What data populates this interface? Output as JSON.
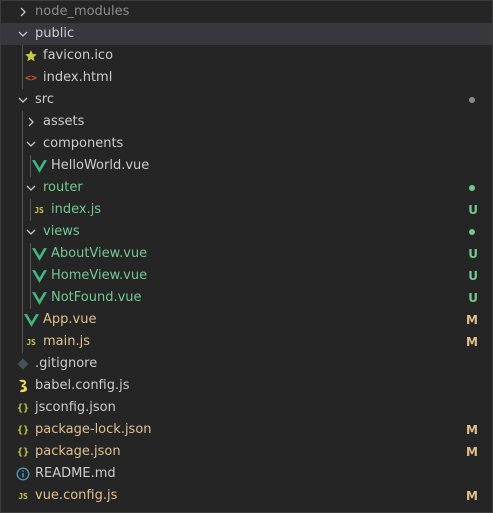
{
  "colors": {
    "background": "#252526",
    "selected_row": "#37373d",
    "untracked": "#73c991",
    "modified": "#e2c08d",
    "ignored": "#8c8c8c",
    "folder_dot": "#8c8c8c",
    "vue_green": "#41b883",
    "js_yellow": "#cbcb41"
  },
  "tree": [
    {
      "label": "node_modules",
      "depth": 0,
      "kind": "folder",
      "expanded": false,
      "status": "ignored",
      "icon": "chevron-right-icon"
    },
    {
      "label": "public",
      "depth": 0,
      "kind": "folder",
      "expanded": true,
      "status": "plain",
      "icon": "chevron-down-icon",
      "selected": true
    },
    {
      "label": "favicon.ico",
      "depth": 1,
      "kind": "file",
      "status": "plain",
      "icon": "star-icon"
    },
    {
      "label": "index.html",
      "depth": 1,
      "kind": "file",
      "status": "plain",
      "icon": "html-icon"
    },
    {
      "label": "src",
      "depth": 0,
      "kind": "folder",
      "expanded": true,
      "status": "plain",
      "icon": "chevron-down-icon",
      "dot": "gray"
    },
    {
      "label": "assets",
      "depth": 1,
      "kind": "folder",
      "expanded": false,
      "status": "plain",
      "icon": "chevron-right-icon"
    },
    {
      "label": "components",
      "depth": 1,
      "kind": "folder",
      "expanded": true,
      "status": "plain",
      "icon": "chevron-down-icon"
    },
    {
      "label": "HelloWorld.vue",
      "depth": 2,
      "kind": "file",
      "status": "plain",
      "icon": "vue-icon"
    },
    {
      "label": "router",
      "depth": 1,
      "kind": "folder",
      "expanded": true,
      "status": "untracked",
      "icon": "chevron-down-icon",
      "dot": "green"
    },
    {
      "label": "index.js",
      "depth": 2,
      "kind": "file",
      "status": "untracked",
      "icon": "js-icon",
      "decoration": "U"
    },
    {
      "label": "views",
      "depth": 1,
      "kind": "folder",
      "expanded": true,
      "status": "untracked",
      "icon": "chevron-down-icon",
      "dot": "green"
    },
    {
      "label": "AboutView.vue",
      "depth": 2,
      "kind": "file",
      "status": "untracked",
      "icon": "vue-icon",
      "decoration": "U"
    },
    {
      "label": "HomeView.vue",
      "depth": 2,
      "kind": "file",
      "status": "untracked",
      "icon": "vue-icon",
      "decoration": "U"
    },
    {
      "label": "NotFound.vue",
      "depth": 2,
      "kind": "file",
      "status": "untracked",
      "icon": "vue-icon",
      "decoration": "U"
    },
    {
      "label": "App.vue",
      "depth": 1,
      "kind": "file",
      "status": "modified",
      "icon": "vue-icon",
      "decoration": "M"
    },
    {
      "label": "main.js",
      "depth": 1,
      "kind": "file",
      "status": "modified",
      "icon": "js-icon",
      "decoration": "M"
    },
    {
      "label": ".gitignore",
      "depth": 0,
      "kind": "file",
      "status": "plain",
      "icon": "git-diamond-icon"
    },
    {
      "label": "babel.config.js",
      "depth": 0,
      "kind": "file",
      "status": "plain",
      "icon": "babel-icon"
    },
    {
      "label": "jsconfig.json",
      "depth": 0,
      "kind": "file",
      "status": "plain",
      "icon": "json-icon"
    },
    {
      "label": "package-lock.json",
      "depth": 0,
      "kind": "file",
      "status": "modified",
      "icon": "json-icon",
      "decoration": "M"
    },
    {
      "label": "package.json",
      "depth": 0,
      "kind": "file",
      "status": "modified",
      "icon": "json-icon",
      "decoration": "M"
    },
    {
      "label": "README.md",
      "depth": 0,
      "kind": "file",
      "status": "plain",
      "icon": "info-icon"
    },
    {
      "label": "vue.config.js",
      "depth": 0,
      "kind": "file",
      "status": "modified",
      "icon": "js-icon",
      "decoration": "M"
    }
  ]
}
